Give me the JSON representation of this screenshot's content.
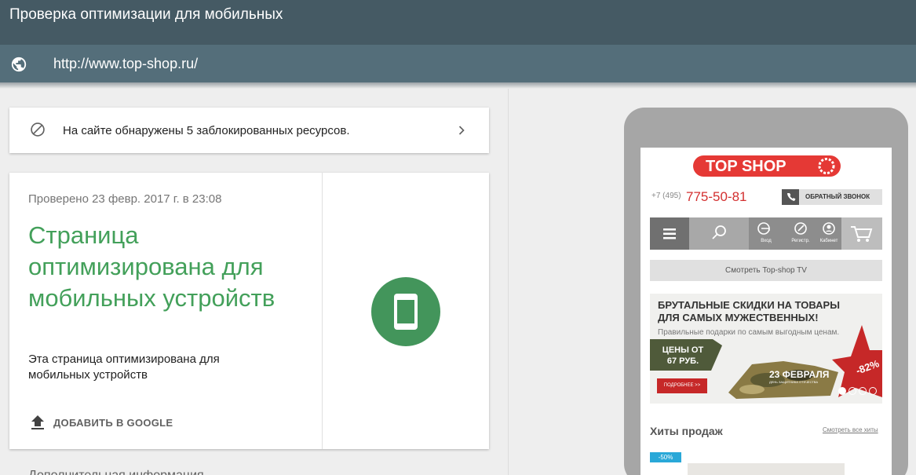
{
  "header": {
    "title": "Проверка оптимизации для мобильных",
    "url": "http://www.top-shop.ru/"
  },
  "blocked": {
    "text": "На сайте обнаружены 5 заблокированных ресурсов."
  },
  "result": {
    "checked": "Проверено 23 февр. 2017 г. в 23:08",
    "headline": "Страница оптимизирована для мобильных устройств",
    "description": "Эта страница оптимизирована для мобильных устройств",
    "add_label": "ДОБАВИТЬ В GOOGLE",
    "accent": "#43a05a"
  },
  "more_info": "Дополнительная информация",
  "preview": {
    "logo_text": "TOP SHOP",
    "phone_prefix": "+7 (495)",
    "phone_number": "775-50-81",
    "callback": "ОБРАТНЫЙ ЗВОНОК",
    "nav": {
      "login": "Вход",
      "register": "Регистр.",
      "cabinet": "Кабинет"
    },
    "tv_button": "Смотреть Top-shop TV",
    "banner": {
      "headline_1": "БРУТАЛЬНЫЕ СКИДКИ НА ТОВАРЫ",
      "headline_2": "ДЛЯ САМЫХ МУЖЕСТВЕННЫХ!",
      "subtitle": "Правильные подарки по самым выгодным ценам.",
      "price_1": "ЦЕНЫ ОТ",
      "price_2": "67 РУБ.",
      "date": "23 ФЕВРАЛЯ",
      "date_sub": "ДЕНЬ ЗАЩИТНИКА ОТЕЧЕСТВА",
      "more": "ПОДРОБНЕЕ >>",
      "discount": "-82%"
    },
    "hits_title": "Хиты продаж",
    "hits_all": "Смотреть все хиты",
    "badge": "-50%"
  }
}
